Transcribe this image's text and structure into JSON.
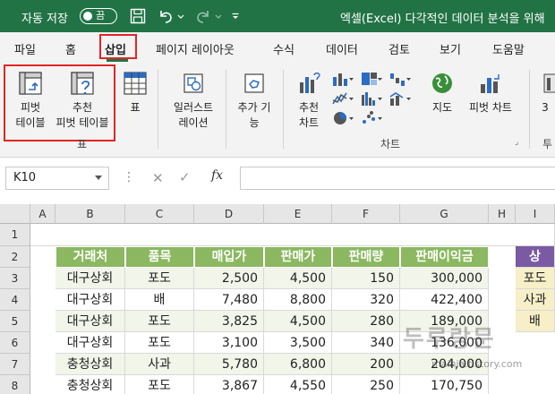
{
  "titlebar": {
    "autosave_label": "자동 저장",
    "autosave_state": "끔",
    "document_title": "엑셀(Excel) 다각적인 데이터 분석을 위해"
  },
  "ribbon_tabs": [
    "파일",
    "홈",
    "삽입",
    "페이지 레이아웃",
    "수식",
    "데이터",
    "검토",
    "보기",
    "도움말"
  ],
  "active_tab": "삽입",
  "ribbon": {
    "pivot_line1": "피벗",
    "pivot_line2": "테이블",
    "rec_pivot_line1": "추천",
    "rec_pivot_line2": "피벗 테이블",
    "table": "표",
    "illustrations_line1": "일러스트",
    "illustrations_line2": "레이션",
    "addins_line1": "추가 기",
    "addins_line2": "능",
    "rec_charts_line1": "추천",
    "rec_charts_line2": "차트",
    "maps": "지도",
    "pivot_chart": "피벗 차트",
    "partial_3d": "3",
    "partial_tour": "투",
    "group_tables": "표",
    "group_charts": "차트"
  },
  "formula_bar": {
    "name_box": "K10",
    "fx": "fx",
    "formula": ""
  },
  "columns": [
    "A",
    "B",
    "C",
    "D",
    "E",
    "F",
    "G",
    "H",
    "I"
  ],
  "rows": [
    "1",
    "2",
    "3",
    "4",
    "5",
    "6",
    "7",
    "8"
  ],
  "table": {
    "headers": [
      "거래처",
      "품목",
      "매입가",
      "판매가",
      "판매량",
      "판매이익금"
    ],
    "rows": [
      [
        "대구상회",
        "포도",
        "2,500",
        "4,500",
        "150",
        "300,000"
      ],
      [
        "대구상회",
        "배",
        "7,480",
        "8,800",
        "320",
        "422,400"
      ],
      [
        "대구상회",
        "포도",
        "3,825",
        "4,500",
        "280",
        "189,000"
      ],
      [
        "대구상회",
        "포도",
        "3,100",
        "3,500",
        "340",
        "136,000"
      ],
      [
        "충청상회",
        "사과",
        "5,780",
        "6,800",
        "200",
        "204,000"
      ],
      [
        "충청상회",
        "포도",
        "3,867",
        "4,550",
        "250",
        "170,750"
      ]
    ]
  },
  "side_table": {
    "header": "상",
    "items": [
      "포도",
      "사과",
      "배"
    ]
  },
  "watermark": {
    "text": "두루랑문",
    "url": "mainia.tistory.com"
  },
  "colors": {
    "excel_green": "#217346",
    "table_header": "#8bb860",
    "highlight_box": "#e02525",
    "side_header": "#7a5aa3",
    "side_cells": "#f6efc8"
  }
}
